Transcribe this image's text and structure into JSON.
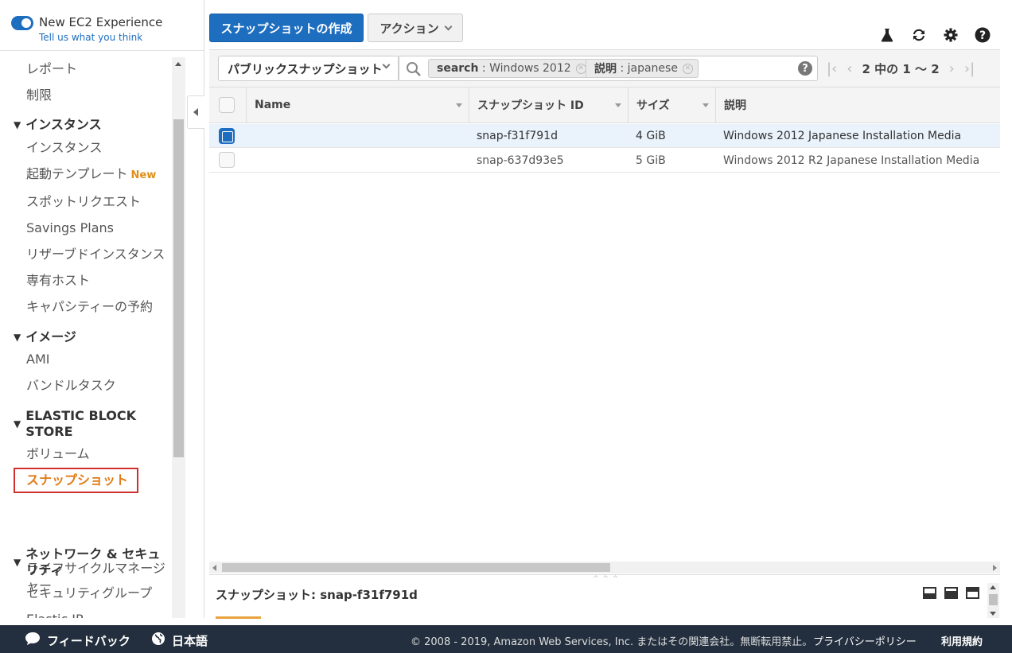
{
  "experience": {
    "title": "New EC2 Experience",
    "link": "Tell us what you think"
  },
  "sidebar": {
    "items": [
      {
        "type": "item",
        "label": "レポート"
      },
      {
        "type": "item",
        "label": "制限"
      },
      {
        "type": "head",
        "label": "インスタンス"
      },
      {
        "type": "item",
        "label": "インスタンス"
      },
      {
        "type": "item",
        "label": "起動テンプレート",
        "badge": "New"
      },
      {
        "type": "item",
        "label": "スポットリクエスト"
      },
      {
        "type": "item",
        "label": "Savings Plans"
      },
      {
        "type": "item",
        "label": "リザーブドインスタンス"
      },
      {
        "type": "item",
        "label": "専有ホスト"
      },
      {
        "type": "item",
        "label": "キャパシティーの予約"
      },
      {
        "type": "head",
        "label": "イメージ"
      },
      {
        "type": "item",
        "label": "AMI"
      },
      {
        "type": "item",
        "label": "バンドルタスク"
      },
      {
        "type": "head",
        "label": "ELASTIC BLOCK STORE"
      },
      {
        "type": "item",
        "label": "ボリューム"
      },
      {
        "type": "item",
        "label": "スナップショット",
        "active": true
      },
      {
        "type": "item",
        "label": "ライフサイクルマネージャー"
      },
      {
        "type": "head",
        "label": "ネットワーク & セキュリティ"
      },
      {
        "type": "item",
        "label": "セキュリティグループ"
      },
      {
        "type": "item",
        "label": "Elastic IP"
      }
    ]
  },
  "toolbar": {
    "create_label": "スナップショットの作成",
    "actions_label": "アクション"
  },
  "icons": {
    "labs": "flask-icon",
    "refresh": "refresh-icon",
    "settings": "gear-icon",
    "help": "help-icon"
  },
  "filter": {
    "scope": "パブリックスナップショット",
    "tokens": [
      {
        "key": "search",
        "value": "Windows 2012"
      },
      {
        "key": "説明",
        "value": "japanese"
      }
    ],
    "help": "?"
  },
  "pager": {
    "text": "2 中の 1 〜 2"
  },
  "table": {
    "columns": [
      "Name",
      "スナップショット ID",
      "サイズ",
      "説明"
    ],
    "rows": [
      {
        "selected": true,
        "name": "",
        "id": "snap-f31f791d",
        "size": "4 GiB",
        "desc": "Windows 2012 Japanese Installation Media"
      },
      {
        "selected": false,
        "name": "",
        "id": "snap-637d93e5",
        "size": "5 GiB",
        "desc": "Windows 2012 R2 Japanese Installation Media"
      }
    ]
  },
  "detail": {
    "title": "スナップショット: snap-f31f791d"
  },
  "footer": {
    "feedback": "フィードバック",
    "language": "日本語",
    "copyright": "© 2008 - 2019, Amazon Web Services, Inc. またはその関連会社。無断転用禁止。",
    "privacy": "プライバシーポリシー",
    "terms": "利用規約"
  },
  "colors": {
    "primary": "#1e6ec0",
    "active": "#e07b16",
    "footer": "#232f3e",
    "highlight_border": "#d0312c"
  }
}
